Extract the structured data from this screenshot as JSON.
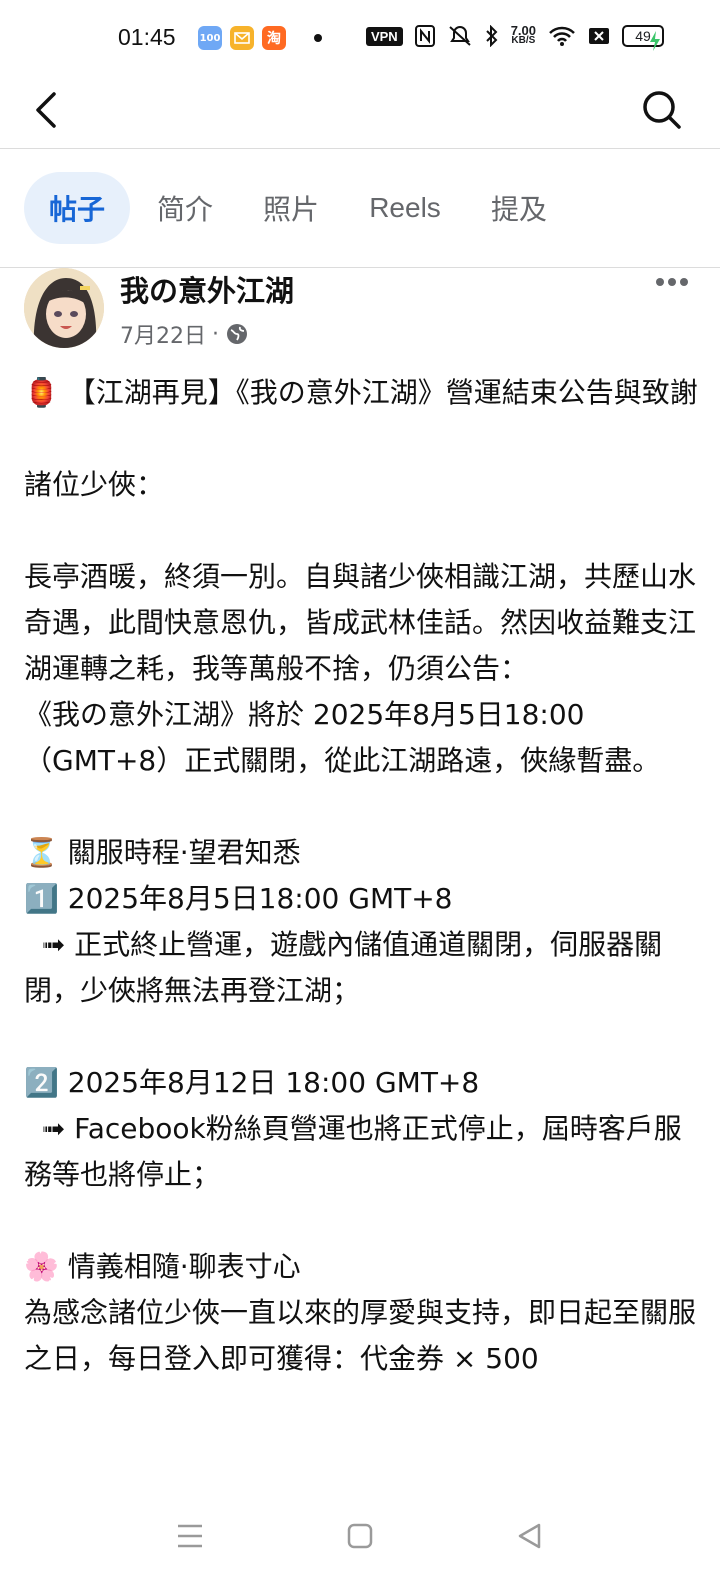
{
  "status_bar": {
    "time": "01:45",
    "vpn": "VPN",
    "net_speed_value": "7.00",
    "net_speed_unit": "KB/S",
    "battery": "49",
    "apps": [
      {
        "icon": "app-100-icon",
        "label": "100",
        "color": "#6fa8f5"
      },
      {
        "icon": "mail-icon",
        "label": "",
        "color": "#f7b32b"
      },
      {
        "icon": "taobao-icon",
        "label": "淘",
        "color": "#ff6a22"
      }
    ]
  },
  "tabs": [
    {
      "label": "帖子",
      "active": true
    },
    {
      "label": "简介",
      "active": false
    },
    {
      "label": "照片",
      "active": false
    },
    {
      "label": "Reels",
      "active": false
    },
    {
      "label": "提及",
      "active": false
    }
  ],
  "post": {
    "author": "我の意外江湖",
    "date": "7月22日",
    "separator": "·",
    "lines": [
      "🏮 【江湖再見】《我の意外江湖》營運結束公告與致謝",
      "",
      "諸位少俠：",
      "",
      "長亭酒暖，終須一別。自與諸少俠相識江湖，共歷山水奇遇，此間快意恩仇，皆成武林佳話。然因收益難支江湖運轉之耗，我等萬般不捨，仍須公告：",
      "《我の意外江湖》將於 2025年8月5日18:00（GMT+8）正式關閉，從此江湖路遠，俠緣暫盡。",
      "",
      "⏳ 關服時程·望君知悉",
      "1️⃣ 2025年8月5日18:00 GMT+8",
      "  ➟ 正式終止營運，遊戲內儲值通道關閉，伺服器關閉，少俠將無法再登江湖；",
      "",
      "2️⃣ 2025年8月12日 18:00 GMT+8",
      "  ➟ Facebook粉絲頁營運也將正式停止，屆時客戶服務等也將停止；",
      "",
      "🌸 情義相隨·聊表寸心",
      "為感念諸位少俠一直以來的厚愛與支持，即日起至關服之日，每日登入即可獲得：代金券 × 500"
    ]
  }
}
